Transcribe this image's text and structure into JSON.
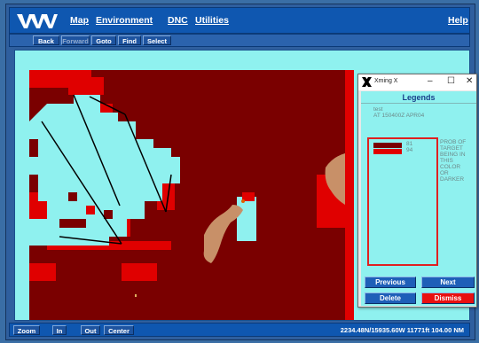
{
  "app": {
    "menu": [
      "Map",
      "Environment",
      "DNC",
      "Utilities"
    ],
    "help": "Help"
  },
  "toolbar": {
    "back": "Back",
    "forward": "Forward",
    "goto": "Goto",
    "find": "Find",
    "select": "Select"
  },
  "status": {
    "zoom": "Zoom",
    "in": "In",
    "out": "Out",
    "center": "Center",
    "coords": "2234.48N/15935.60W  11771ft  104.00  NM"
  },
  "legend_window": {
    "title": "Xming X",
    "header": "Legends",
    "subtitle1": "test",
    "subtitle2": "AT 150400Z APR04",
    "entries": [
      {
        "value": "81",
        "color": "#7a0000"
      },
      {
        "value": "94",
        "color": "#e00000"
      }
    ],
    "description": "PROB OF TARGET BEING IN THIS COLOR OR DARKER",
    "buttons": {
      "previous": "Previous",
      "next": "Next",
      "delete": "Delete",
      "dismiss": "Dismiss"
    }
  },
  "colors": {
    "map_bg": "#8ff1ef",
    "dark_red": "#7a0000",
    "red": "#e00000",
    "land": "#c89068",
    "button_blue": "#1e5fb8",
    "dismiss_red": "#e81010"
  }
}
